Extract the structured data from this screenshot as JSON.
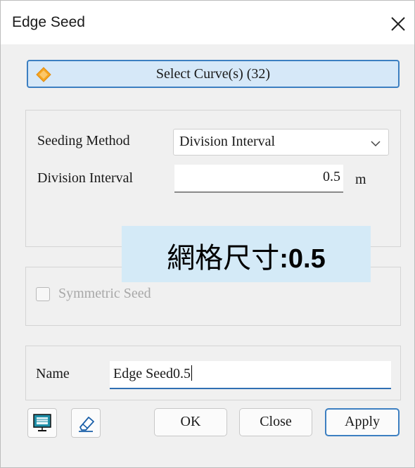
{
  "window": {
    "title": "Edge Seed"
  },
  "select": {
    "label": "Select Curve(s) (32)"
  },
  "seeding": {
    "method_label": "Seeding Method",
    "method_value": "Division Interval",
    "interval_label": "Division Interval",
    "interval_value": "0.5",
    "unit": "m"
  },
  "overlay": {
    "cjk": "網格尺寸",
    "bold": ":0.5"
  },
  "symmetric": {
    "label": "Symmetric Seed",
    "checked": false
  },
  "name": {
    "label": "Name",
    "value": "Edge Seed0.5"
  },
  "buttons": {
    "ok": "OK",
    "close": "Close",
    "apply": "Apply"
  },
  "colors": {
    "accent": "#3c7fc1",
    "overlay_bg": "#d4eaf7",
    "icon_orange": "#f5a623"
  }
}
